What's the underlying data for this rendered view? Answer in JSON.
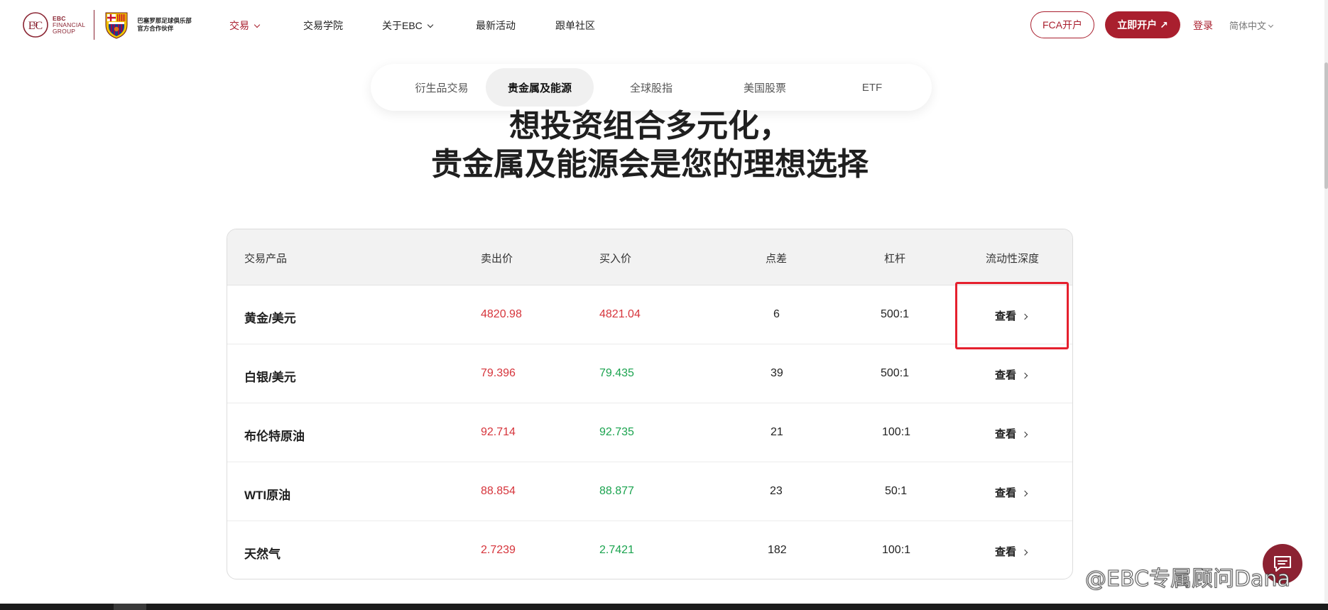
{
  "header": {
    "brand": {
      "line1": "EBC",
      "line2": "FINANCIAL",
      "line3": "GROUP"
    },
    "partner": {
      "line1": "巴塞罗那足球俱乐部",
      "line2": "官方合作伙伴"
    },
    "nav": [
      {
        "label": "交易",
        "active": true,
        "dropdown": true
      },
      {
        "label": "交易学院",
        "active": false,
        "dropdown": false
      },
      {
        "label": "关于EBC",
        "active": false,
        "dropdown": true
      },
      {
        "label": "最新活动",
        "active": false,
        "dropdown": false
      },
      {
        "label": "跟单社区",
        "active": false,
        "dropdown": false
      }
    ],
    "fca_button": "FCA开户",
    "open_button": "立即开户 ↗",
    "login": "登录",
    "language": "简体中文"
  },
  "tabs": [
    {
      "label": "衍生品交易",
      "active": false
    },
    {
      "label": "贵金属及能源",
      "active": true
    },
    {
      "label": "全球股指",
      "active": false
    },
    {
      "label": "美国股票",
      "active": false
    },
    {
      "label": "ETF",
      "active": false
    }
  ],
  "headline": {
    "line1": "想投资组合多元化，",
    "line2": "贵金属及能源会是您的理想选择"
  },
  "table": {
    "columns": [
      "交易产品",
      "卖出价",
      "买入价",
      "点差",
      "杠杆",
      "流动性深度"
    ],
    "rows": [
      {
        "product": "黄金/美元",
        "sell": "4820.98",
        "buy": "4821.04",
        "buy_color": "red",
        "spread": "6",
        "leverage": "500:1",
        "action": "查看"
      },
      {
        "product": "白银/美元",
        "sell": "79.396",
        "buy": "79.435",
        "buy_color": "green",
        "spread": "39",
        "leverage": "500:1",
        "action": "查看"
      },
      {
        "product": "布伦特原油",
        "sell": "92.714",
        "buy": "92.735",
        "buy_color": "green",
        "spread": "21",
        "leverage": "100:1",
        "action": "查看"
      },
      {
        "product": "WTI原油",
        "sell": "88.854",
        "buy": "88.877",
        "buy_color": "green",
        "spread": "23",
        "leverage": "50:1",
        "action": "查看"
      },
      {
        "product": "天然气",
        "sell": "2.7239",
        "buy": "2.7421",
        "buy_color": "green",
        "spread": "182",
        "leverage": "100:1",
        "action": "查看"
      }
    ]
  },
  "watermark": "@EBC专属顾问Dana",
  "colors": {
    "brand": "#a91f2e",
    "sell_red": "#d6343b",
    "buy_green": "#1ba34f",
    "highlight": "#e5202e"
  }
}
